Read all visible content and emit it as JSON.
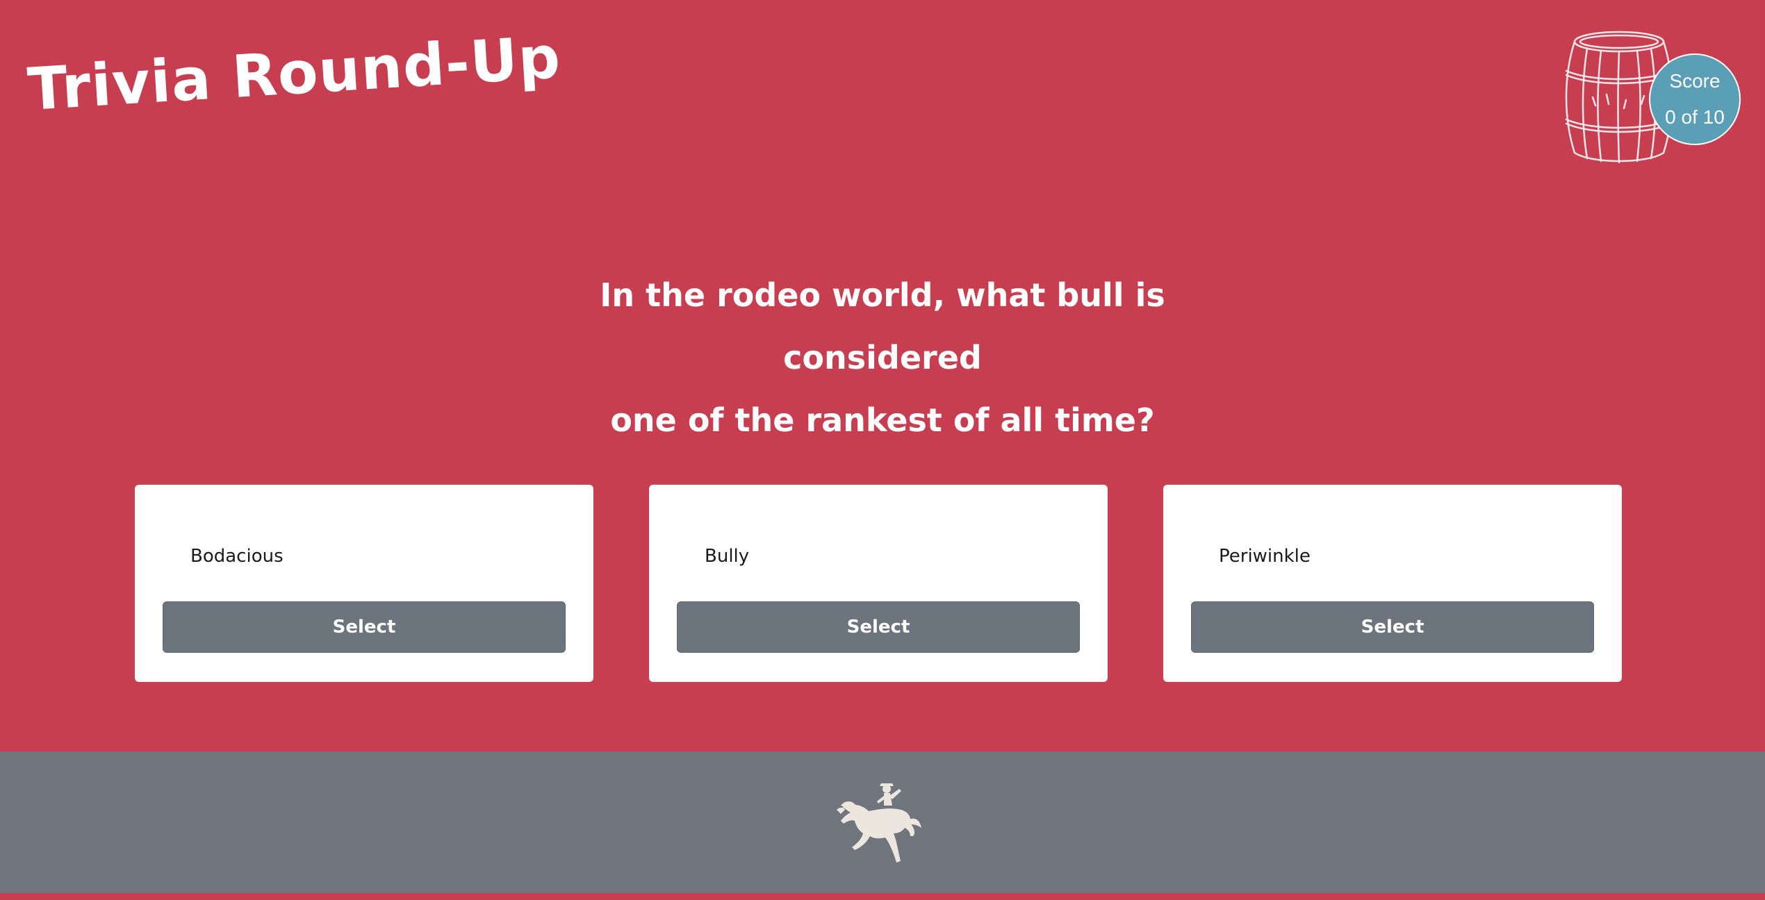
{
  "header": {
    "title": "Trivia Round-Up"
  },
  "score": {
    "label": "Score",
    "value": "0 of 10",
    "badge_color": "#5a9fb6"
  },
  "question": {
    "line1": "In the rodeo world, what bull is considered",
    "line2": "one of the rankest of all time?"
  },
  "answers": [
    {
      "label": "Bodacious",
      "button": "Select"
    },
    {
      "label": "Bully",
      "button": "Select"
    },
    {
      "label": "Periwinkle",
      "button": "Select"
    }
  ],
  "footer": {
    "icon": "bucking-horse-rider-icon"
  },
  "colors": {
    "background": "#c83e51",
    "footer": "#70757d",
    "button": "#6c757d",
    "card": "#ffffff"
  }
}
